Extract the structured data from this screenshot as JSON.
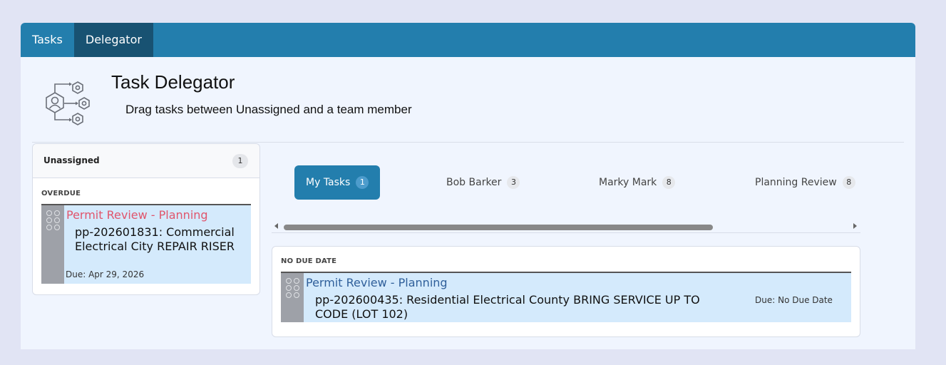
{
  "nav": {
    "tabs": [
      "Tasks",
      "Delegator"
    ],
    "active": "Delegator"
  },
  "header": {
    "icon": "team-delegation-icon",
    "title": "Task Delegator",
    "subtitle": "Drag tasks between Unassigned and a team member"
  },
  "unassigned": {
    "title": "Unassigned",
    "count": "1",
    "group": "OVERDUE",
    "task": {
      "type": "Permit Review - Planning",
      "name": "pp-202601831: Commercial Electrical City REPAIR RISER",
      "due": "Due: Apr 29, 2026"
    }
  },
  "members": {
    "tabs": [
      {
        "label": "My Tasks",
        "count": "1"
      },
      {
        "label": "Bob Barker",
        "count": "3"
      },
      {
        "label": "Marky Mark",
        "count": "8"
      },
      {
        "label": "Planning Review",
        "count": "8"
      }
    ],
    "active": "My Tasks",
    "group": "NO DUE DATE",
    "task": {
      "type": "Permit Review - Planning",
      "name": "pp-202600435: Residential Electrical County BRING SERVICE UP TO CODE (LOT 102)",
      "due": "Due: No Due Date"
    }
  },
  "colors": {
    "nav_bg": "#237ead",
    "nav_active": "#185272",
    "overdue_type": "#e0556c",
    "normal_type": "#2f5f9a",
    "card_bg": "#d4eafc",
    "page_bg": "#e1e4f4"
  }
}
